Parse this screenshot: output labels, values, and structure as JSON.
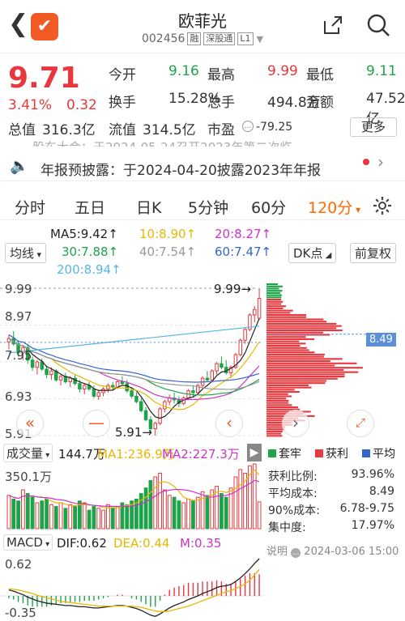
{
  "header": {
    "stock_name": "欧菲光",
    "code": "002456",
    "tags": [
      "融",
      "深股通",
      "L1"
    ]
  },
  "quote": {
    "price": "9.71",
    "change_pct": "3.41%",
    "change": "0.32",
    "fields": [
      {
        "label": "今开",
        "value": "9.16",
        "color": "green"
      },
      {
        "label": "最高",
        "value": "9.99",
        "color": "red"
      },
      {
        "label": "最低",
        "value": "9.11",
        "color": "green"
      },
      {
        "label": "换手",
        "value": "15.28%",
        "color": "default"
      },
      {
        "label": "总手",
        "value": "494.8万",
        "color": "default"
      },
      {
        "label": "金额",
        "value": "47.52亿",
        "color": "default"
      },
      {
        "label": "总值",
        "value": "316.3亿",
        "color": "default"
      },
      {
        "label": "流值",
        "value": "314.5亿",
        "color": "default"
      },
      {
        "label": "市盈",
        "value": "-79.25",
        "color": "default"
      }
    ],
    "more_label": "更多"
  },
  "news": {
    "ghost_text": "股东大会：于2024-05-24召开2023年第二次临...",
    "text": "年报预披露：于2024-04-20披露2023年年报"
  },
  "tabs": {
    "items": [
      "分时",
      "五日",
      "日K",
      "5分钟",
      "60分",
      "120分"
    ],
    "active_index": 5
  },
  "ma": {
    "ma5": "MA5:9.42↑",
    "ma10": "10:8.90↑",
    "ma20": "20:8.27↑",
    "ma30": "30:7.88↑",
    "ma40": "40:7.54↑",
    "ma60": "60:7.47↑",
    "ma200": "200:8.94↑",
    "line_type": "均线",
    "dk_label": "DK点",
    "adjust_label": "前复权",
    "colors": {
      "ma5": "#222222",
      "ma10": "#e6b800",
      "ma20": "#cc33cc",
      "ma30": "#1ea34a",
      "ma40": "#999999",
      "ma60": "#3366cc",
      "ma200": "#55b7e0"
    }
  },
  "price_axis": {
    "labels": [
      "9.99",
      "8.97",
      "7.95",
      "6.93",
      "5.91"
    ],
    "high_marker": "9.99→",
    "low_marker": "5.91→",
    "chip_price": "8.49"
  },
  "chip_legend": {
    "trapped": "套牢",
    "profit": "获利",
    "average": "平均",
    "colors": {
      "trapped": "#1ea34a",
      "profit": "#e8383d",
      "average": "#3366cc"
    }
  },
  "chip_stats": [
    {
      "label": "获利比例:",
      "value": "93.96%"
    },
    {
      "label": "平均成本:",
      "value": "8.49"
    },
    {
      "label": "90%成本:",
      "value": "6.78-9.75"
    },
    {
      "label": "集中度:",
      "value": "17.97%"
    }
  ],
  "chip_note": "说明",
  "chip_date": "2024-03-06 15:00",
  "volume": {
    "label": "成交量",
    "current": "144.7万",
    "ma1": "MA1:236.9万",
    "ma2": "MA2:227.3万",
    "max_label": "350.1万"
  },
  "macd": {
    "label": "MACD",
    "dif": "DIF:0.62",
    "dea": "DEA:0.44",
    "m": "M:0.35",
    "top": "0.62",
    "bottom": "-0.35"
  },
  "chart_data": {
    "type": "candlestick",
    "ylim": [
      5.91,
      9.99
    ],
    "candles": [
      [
        8.5,
        8.7,
        8.3,
        8.6
      ],
      [
        8.6,
        8.8,
        8.4,
        8.45
      ],
      [
        8.45,
        8.55,
        8.1,
        8.2
      ],
      [
        8.2,
        8.4,
        8.0,
        8.35
      ],
      [
        8.35,
        8.45,
        7.9,
        8.0
      ],
      [
        8.0,
        8.1,
        7.7,
        7.8
      ],
      [
        7.8,
        8.0,
        7.6,
        7.95
      ],
      [
        7.95,
        8.05,
        7.7,
        7.75
      ],
      [
        7.75,
        7.85,
        7.5,
        7.6
      ],
      [
        7.6,
        7.8,
        7.45,
        7.7
      ],
      [
        7.7,
        7.75,
        7.4,
        7.45
      ],
      [
        7.45,
        7.6,
        7.3,
        7.55
      ],
      [
        7.55,
        7.65,
        7.35,
        7.4
      ],
      [
        7.4,
        7.55,
        7.25,
        7.5
      ],
      [
        7.5,
        7.6,
        7.3,
        7.35
      ],
      [
        7.35,
        7.45,
        7.1,
        7.2
      ],
      [
        7.2,
        7.35,
        7.05,
        7.3
      ],
      [
        7.3,
        7.4,
        7.15,
        7.2
      ],
      [
        7.2,
        7.3,
        6.95,
        7.0
      ],
      [
        7.0,
        7.15,
        6.9,
        7.1
      ],
      [
        7.1,
        7.25,
        7.0,
        7.2
      ],
      [
        7.2,
        7.35,
        7.1,
        7.3
      ],
      [
        7.3,
        7.4,
        7.15,
        7.25
      ],
      [
        7.25,
        7.45,
        7.2,
        7.4
      ],
      [
        7.4,
        7.55,
        7.3,
        7.35
      ],
      [
        7.35,
        7.45,
        7.1,
        7.15
      ],
      [
        7.15,
        7.25,
        6.95,
        7.0
      ],
      [
        7.0,
        7.1,
        6.8,
        6.85
      ],
      [
        6.85,
        6.95,
        6.55,
        6.6
      ],
      [
        6.6,
        6.7,
        6.3,
        6.35
      ],
      [
        6.35,
        6.45,
        6.0,
        6.1
      ],
      [
        6.1,
        6.3,
        5.91,
        6.25
      ],
      [
        6.25,
        6.7,
        6.2,
        6.65
      ],
      [
        6.65,
        6.9,
        6.55,
        6.85
      ],
      [
        6.85,
        7.05,
        6.75,
        6.95
      ],
      [
        6.95,
        7.1,
        6.8,
        6.9
      ],
      [
        6.9,
        7.0,
        6.7,
        6.8
      ],
      [
        6.8,
        7.0,
        6.75,
        6.95
      ],
      [
        6.95,
        7.2,
        6.9,
        7.15
      ],
      [
        7.15,
        7.3,
        7.0,
        7.1
      ],
      [
        7.1,
        7.35,
        7.05,
        7.3
      ],
      [
        7.3,
        7.55,
        7.25,
        7.5
      ],
      [
        7.5,
        7.7,
        7.4,
        7.45
      ],
      [
        7.45,
        7.75,
        7.4,
        7.7
      ],
      [
        7.7,
        7.95,
        7.6,
        7.9
      ],
      [
        7.9,
        8.1,
        7.75,
        7.8
      ],
      [
        7.8,
        8.0,
        7.6,
        7.65
      ],
      [
        7.65,
        7.85,
        7.5,
        7.8
      ],
      [
        7.8,
        8.2,
        7.75,
        8.15
      ],
      [
        8.15,
        8.6,
        8.1,
        8.55
      ],
      [
        8.55,
        8.9,
        8.45,
        8.85
      ],
      [
        8.85,
        9.3,
        8.8,
        9.25
      ],
      [
        9.25,
        9.5,
        9.05,
        9.4
      ],
      [
        9.16,
        9.99,
        9.11,
        9.71
      ]
    ],
    "volume": [
      180,
      160,
      150,
      210,
      190,
      170,
      140,
      150,
      160,
      130,
      120,
      140,
      110,
      130,
      120,
      150,
      140,
      100,
      120,
      110,
      100,
      130,
      110,
      120,
      140,
      130,
      150,
      160,
      190,
      220,
      260,
      280,
      300,
      210,
      180,
      170,
      150,
      140,
      160,
      150,
      170,
      200,
      180,
      210,
      230,
      190,
      170,
      220,
      280,
      320,
      300,
      340,
      350,
      145
    ],
    "macd_dif": [
      0.1,
      0.08,
      0.05,
      0.02,
      -0.02,
      -0.05,
      -0.08,
      -0.1,
      -0.12,
      -0.13,
      -0.14,
      -0.15,
      -0.16,
      -0.16,
      -0.17,
      -0.18,
      -0.18,
      -0.19,
      -0.2,
      -0.2,
      -0.19,
      -0.18,
      -0.17,
      -0.16,
      -0.16,
      -0.17,
      -0.19,
      -0.21,
      -0.24,
      -0.28,
      -0.32,
      -0.34,
      -0.3,
      -0.25,
      -0.2,
      -0.16,
      -0.13,
      -0.1,
      -0.06,
      -0.03,
      0.0,
      0.04,
      0.07,
      0.1,
      0.14,
      0.16,
      0.17,
      0.19,
      0.24,
      0.3,
      0.37,
      0.45,
      0.54,
      0.62
    ],
    "macd_dea": [
      0.12,
      0.11,
      0.1,
      0.08,
      0.06,
      0.04,
      0.01,
      -0.01,
      -0.03,
      -0.05,
      -0.07,
      -0.09,
      -0.1,
      -0.11,
      -0.12,
      -0.13,
      -0.14,
      -0.15,
      -0.16,
      -0.17,
      -0.17,
      -0.17,
      -0.17,
      -0.17,
      -0.17,
      -0.17,
      -0.17,
      -0.18,
      -0.19,
      -0.21,
      -0.23,
      -0.25,
      -0.26,
      -0.26,
      -0.25,
      -0.23,
      -0.21,
      -0.19,
      -0.17,
      -0.14,
      -0.11,
      -0.08,
      -0.05,
      -0.02,
      0.01,
      0.04,
      0.07,
      0.09,
      0.12,
      0.16,
      0.2,
      0.26,
      0.35,
      0.44
    ]
  }
}
